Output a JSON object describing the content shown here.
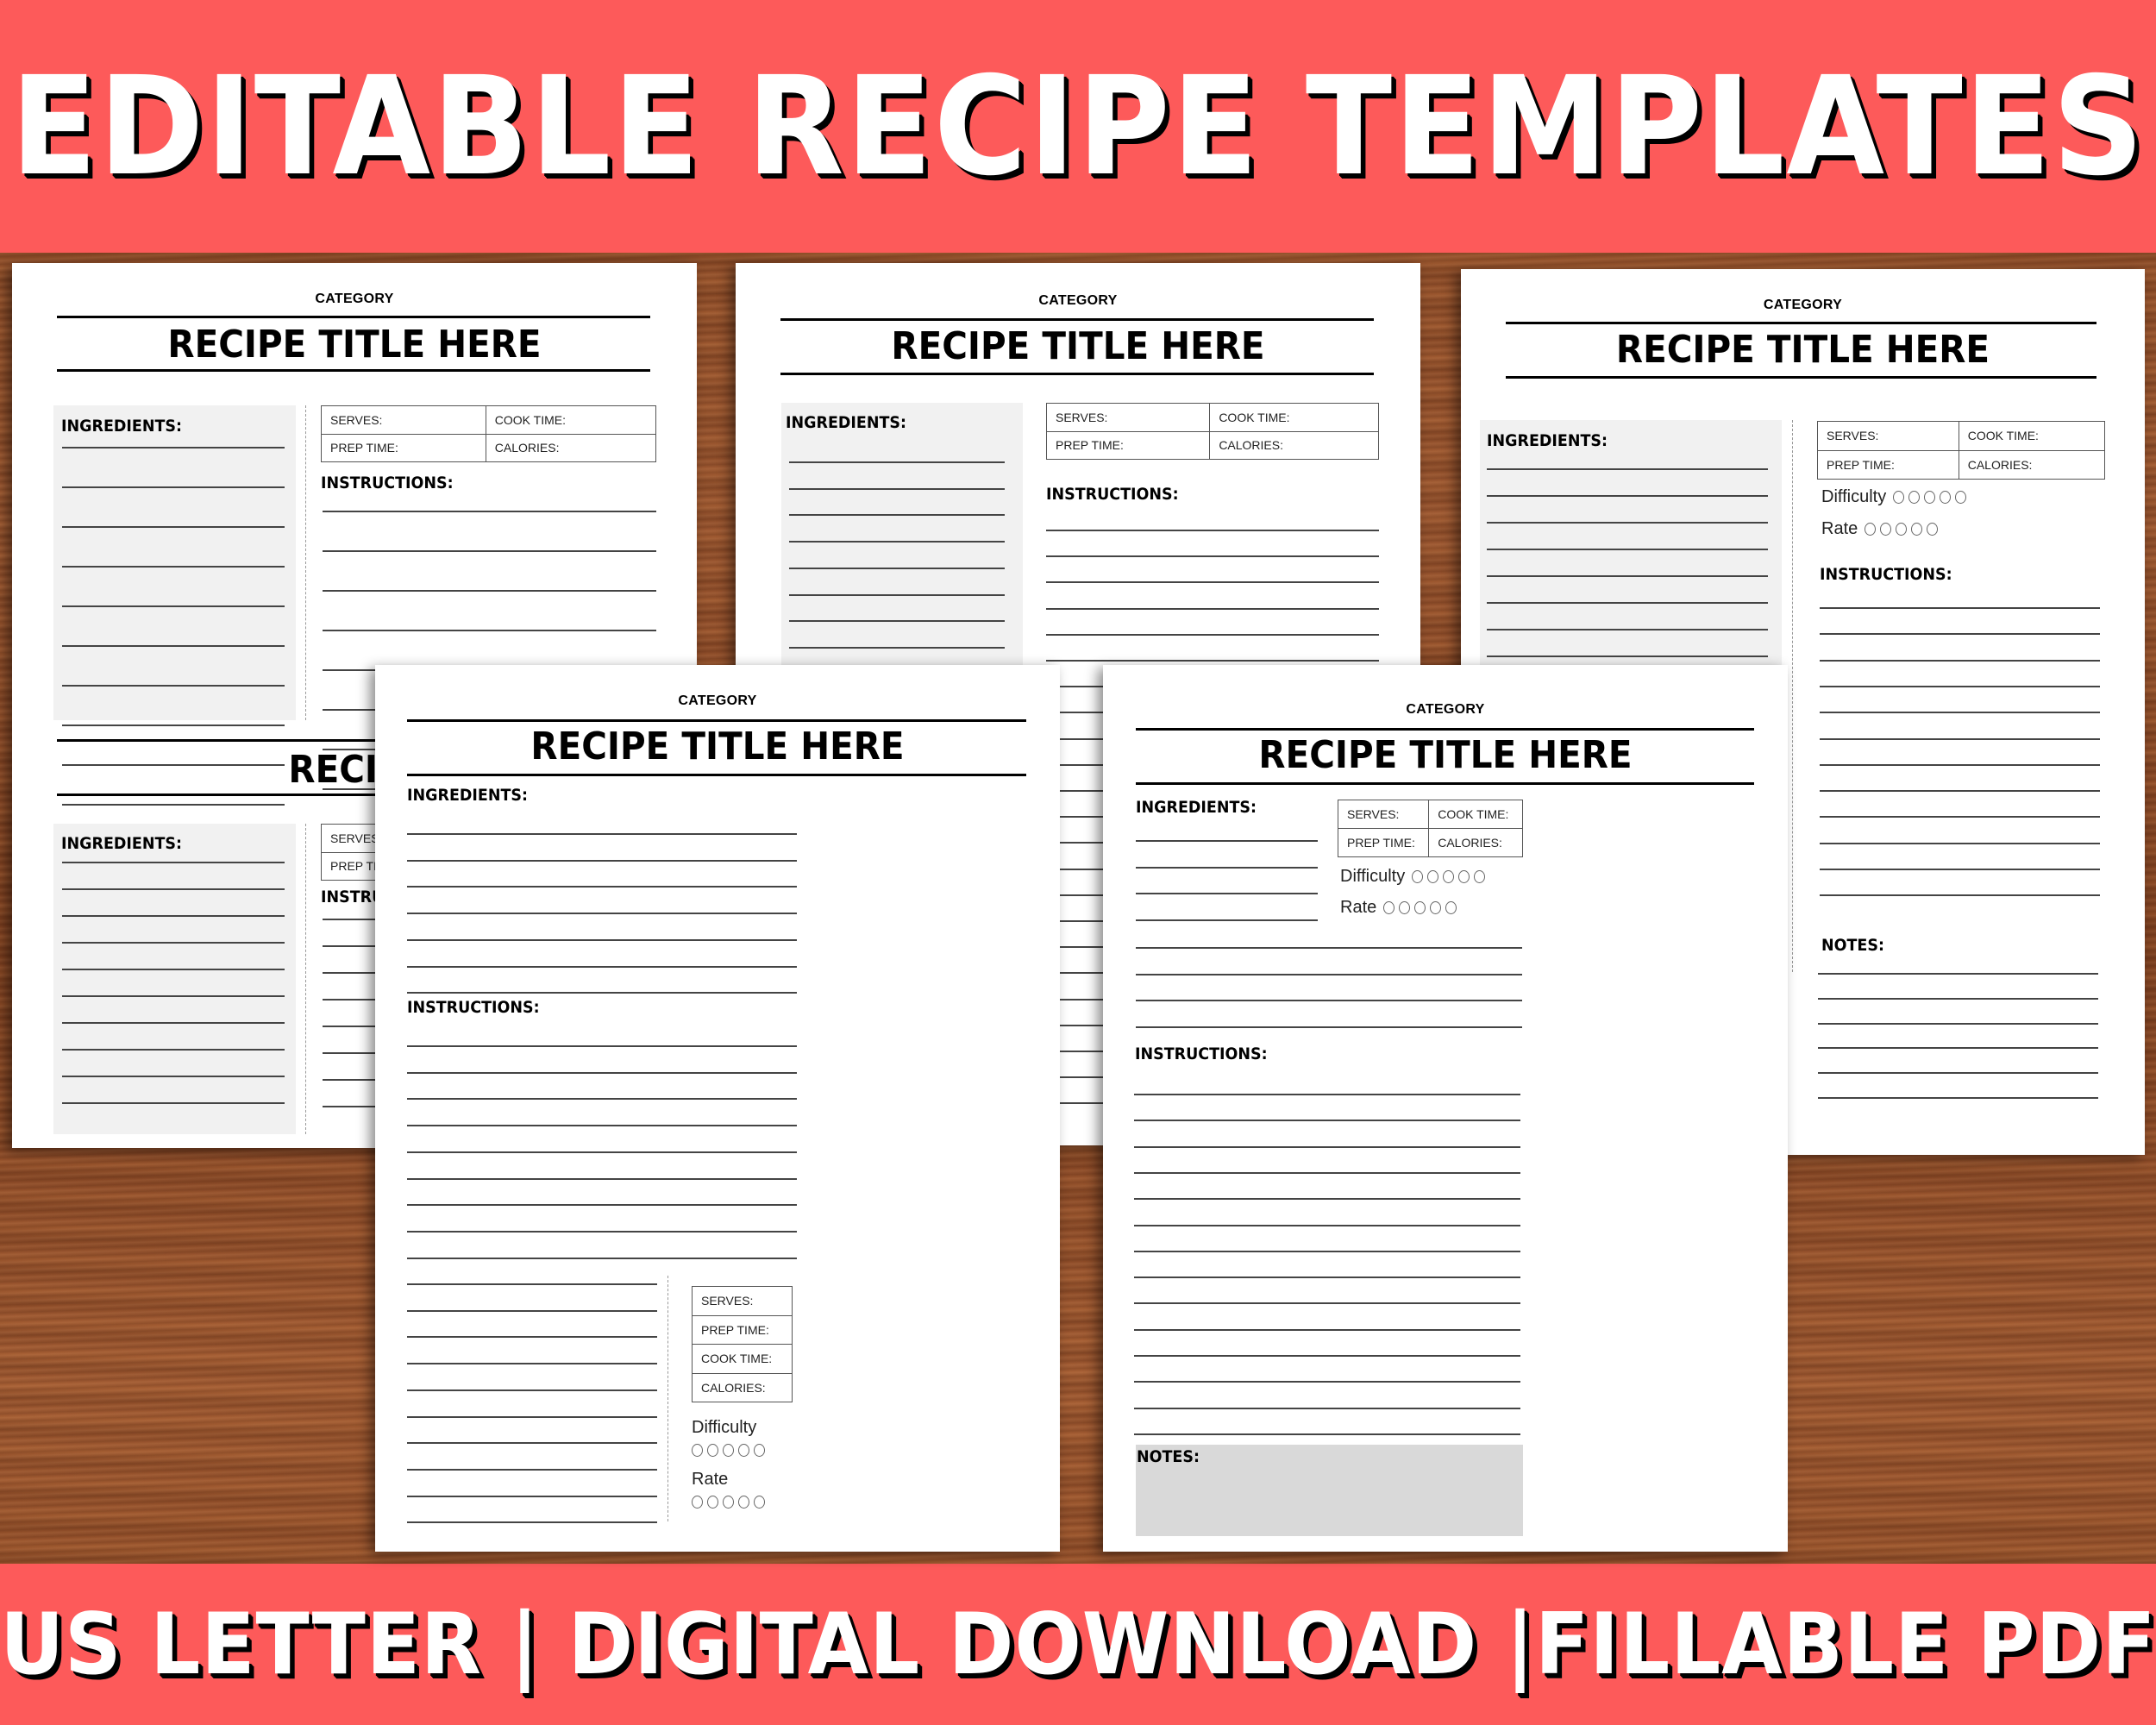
{
  "header": {
    "headline": "EDITABLE RECIPE TEMPLATES"
  },
  "footer": {
    "tagline": "US LETTER | DIGITAL DOWNLOAD |FILLABLE PDF"
  },
  "colors": {
    "banner": "#fd5a5a",
    "banner_text": "#ffffff",
    "ink": "#000000",
    "shaded_box": "#f1f1f1",
    "notes_box": "#d9d9d9"
  },
  "labels": {
    "category": "CATEGORY",
    "title": "RECIPE TITLE HERE",
    "ingredients": "INGREDIENTS:",
    "instructions": "INSTRUCTIONS:",
    "notes": "NOTES:",
    "serves": "SERVES:",
    "cook_time": "COOK TIME:",
    "prep_time": "PREP TIME:",
    "calories": "CALORIES:",
    "difficulty": "Difficulty",
    "rate": "Rate"
  },
  "rating_scale": {
    "difficulty_circles": 5,
    "rate_circles": 5,
    "difficulty_value": 0,
    "rate_value": 0
  },
  "templates": [
    {
      "id": "classic-two-column",
      "has_difficulty": false,
      "has_notes": false
    },
    {
      "id": "two-column-spaced",
      "has_difficulty": false,
      "has_notes": false
    },
    {
      "id": "two-column-rating-notes",
      "has_difficulty": true,
      "has_notes": true
    },
    {
      "id": "full-width-sidebar-stats",
      "has_difficulty": true,
      "has_notes": false
    },
    {
      "id": "full-width-notes-box",
      "has_difficulty": true,
      "has_notes": true
    }
  ]
}
